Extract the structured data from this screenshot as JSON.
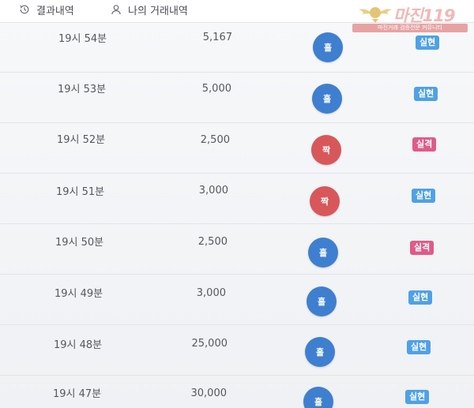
{
  "tabs": [
    {
      "label": "결과내역",
      "icon": "history-icon"
    },
    {
      "label": "나의 거래내역",
      "icon": "person-icon"
    }
  ],
  "watermark": {
    "brand": "마진119",
    "tagline": "마진거래 검증전문 커뮤니티"
  },
  "colors": {
    "odd": "#3f7fd0",
    "even": "#d8575a",
    "hit": "#4fa1e6",
    "miss": "#e05b87"
  },
  "rows": [
    {
      "time": "19시 54분",
      "amount": "5,167",
      "result": "홀",
      "status": "실현"
    },
    {
      "time": "19시 53분",
      "amount": "5,000",
      "result": "홀",
      "status": "실현"
    },
    {
      "time": "19시 52분",
      "amount": "2,500",
      "result": "짝",
      "status": "실격"
    },
    {
      "time": "19시 51분",
      "amount": "3,000",
      "result": "짝",
      "status": "실현"
    },
    {
      "time": "19시 50분",
      "amount": "2,500",
      "result": "홀",
      "status": "실격"
    },
    {
      "time": "19시 49분",
      "amount": "3,000",
      "result": "홀",
      "status": "실현"
    },
    {
      "time": "19시 48분",
      "amount": "25,000",
      "result": "홀",
      "status": "실현"
    },
    {
      "time": "19시 47분",
      "amount": "30,000",
      "result": "홀",
      "status": "실현"
    }
  ]
}
